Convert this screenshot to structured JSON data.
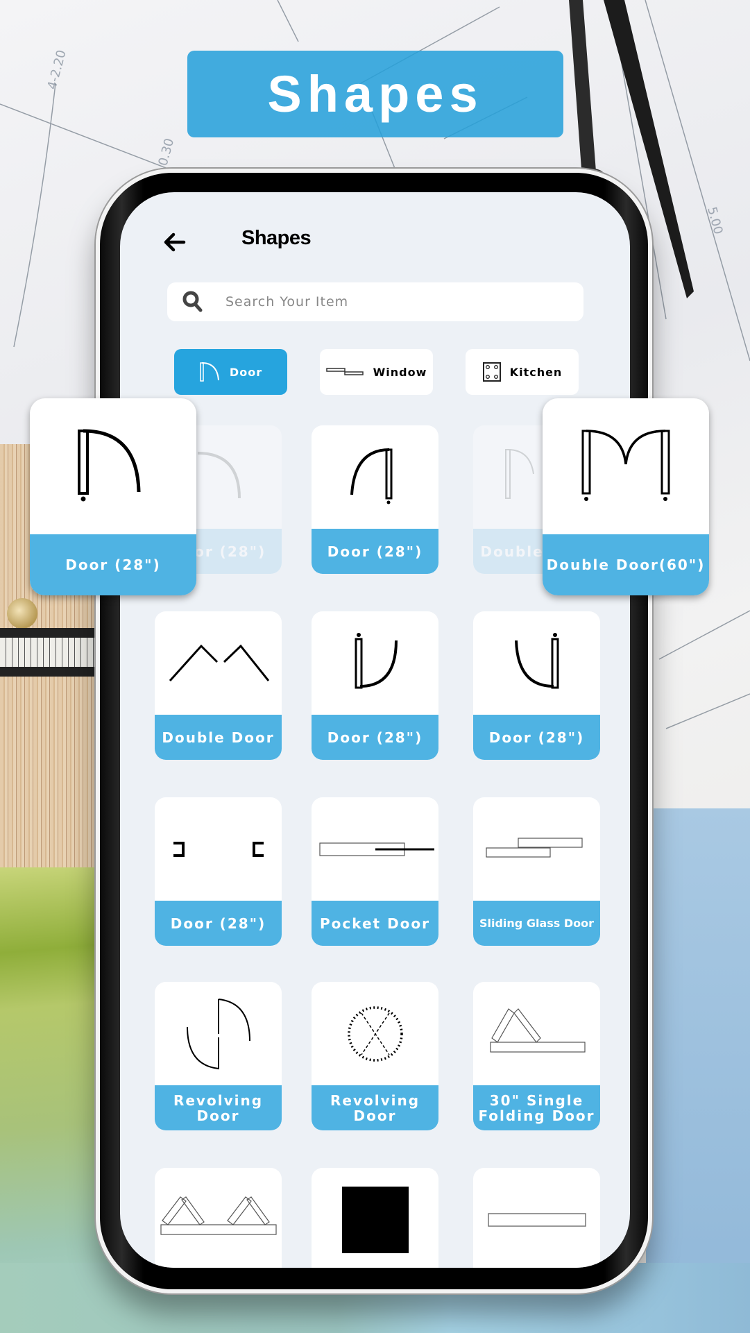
{
  "banner": {
    "title": "Shapes"
  },
  "app": {
    "title": "Shapes",
    "back_icon": "arrow-left-icon",
    "search": {
      "placeholder": "Search Your Item",
      "value": "",
      "icon": "search-icon"
    }
  },
  "tabs": [
    {
      "label": "Door",
      "icon": "door-swing-icon",
      "active": true
    },
    {
      "label": "Window",
      "icon": "window-icon",
      "active": false
    },
    {
      "label": "Kitchen",
      "icon": "kitchen-stove-icon",
      "active": false
    }
  ],
  "popups": [
    {
      "label": "Door (28\")",
      "icon": "door-swing-left-icon",
      "side": "left"
    },
    {
      "label": "Double Door(60\")",
      "icon": "double-door-icon",
      "side": "right"
    }
  ],
  "items": [
    {
      "label": "Door (28\")",
      "icon": "door-swing-left-icon",
      "faded": true
    },
    {
      "label": "Door (28\")",
      "icon": "door-swing-right-icon",
      "faded": false
    },
    {
      "label": "Double Door",
      "icon": "double-door-icon",
      "faded": true
    },
    {
      "label": "Double Door",
      "icon": "double-door-open-icon",
      "faded": false
    },
    {
      "label": "Door (28\")",
      "icon": "door-swing-down-right-icon",
      "faded": false
    },
    {
      "label": "Door (28\")",
      "icon": "door-swing-down-left-icon",
      "faded": false
    },
    {
      "label": "Door (28\")",
      "icon": "door-opening-icon",
      "faded": false
    },
    {
      "label": "Pocket Door",
      "icon": "pocket-door-icon",
      "faded": false
    },
    {
      "label": "Sliding Glass Door",
      "icon": "sliding-glass-door-icon",
      "faded": false
    },
    {
      "label": "Revolving Door",
      "icon": "revolving-door-icon",
      "faded": false
    },
    {
      "label": "Revolving Door",
      "icon": "revolving-door-circle-icon",
      "faded": false
    },
    {
      "label": "30\" Single Folding Door",
      "icon": "single-folding-door-icon",
      "faded": false
    },
    {
      "label": "",
      "icon": "double-folding-door-icon",
      "faded": false
    },
    {
      "label": "",
      "icon": "solid-block-icon",
      "faded": false
    },
    {
      "label": "",
      "icon": "wall-panel-icon",
      "faded": false
    }
  ],
  "colors": {
    "accent": "#26a4de",
    "card_label": "#4fb3e3",
    "screen_bg": "#edf1f6"
  }
}
